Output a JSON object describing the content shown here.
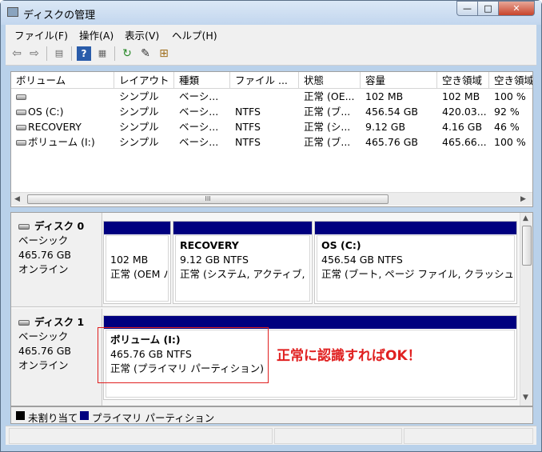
{
  "window": {
    "title": "ディスクの管理",
    "controls": [
      "—",
      "□",
      "✕"
    ]
  },
  "menu": [
    "ファイル(F)",
    "操作(A)",
    "表示(V)",
    "ヘルプ(H)"
  ],
  "toolbar": {
    "icons": [
      "back-arrow-icon",
      "forward-arrow-icon",
      "list-view-icon",
      "help-icon",
      "console-view-icon",
      "refresh-icon",
      "properties-icon",
      "rescan-icon"
    ]
  },
  "volume_list": {
    "columns": [
      "ボリューム",
      "レイアウト",
      "種類",
      "ファイル ...",
      "状態",
      "容量",
      "空き領域",
      "空き領域"
    ],
    "rows": [
      [
        "",
        "シンプル",
        "ベーシ...",
        "",
        "正常 (OE...",
        "102 MB",
        "102 MB",
        "100 %"
      ],
      [
        "OS (C:)",
        "シンプル",
        "ベーシ...",
        "NTFS",
        "正常 (ブ...",
        "456.54 GB",
        "420.03...",
        "92 %"
      ],
      [
        "RECOVERY",
        "シンプル",
        "ベーシ...",
        "NTFS",
        "正常 (シ...",
        "9.12 GB",
        "4.16 GB",
        "46 %"
      ],
      [
        "ボリューム (I:)",
        "シンプル",
        "ベーシ...",
        "NTFS",
        "正常 (ブ...",
        "465.76 GB",
        "465.66...",
        "100 %"
      ]
    ],
    "scroll_grip": "III"
  },
  "disks": [
    {
      "name": "ディスク 0",
      "type": "ベーシック",
      "size": "465.76 GB",
      "status": "オンライン",
      "partitions": [
        {
          "name": "",
          "size": "102 MB",
          "status": "正常 (OEM パ"
        },
        {
          "name": "RECOVERY",
          "size": "9.12 GB NTFS",
          "status": "正常 (システム, アクティブ, プ"
        },
        {
          "name": "OS  (C:)",
          "size": "456.54 GB NTFS",
          "status": "正常 (ブート, ページ ファイル, クラッシュ ダ"
        }
      ]
    },
    {
      "name": "ディスク 1",
      "type": "ベーシック",
      "size": "465.76 GB",
      "status": "オンライン",
      "partitions": [
        {
          "name": "ボリューム  (I:)",
          "size": "465.76 GB NTFS",
          "status": "正常 (プライマリ パーティション)"
        }
      ]
    }
  ],
  "annotation": "正常に認識すればOK！",
  "legend": [
    {
      "label": "未割り当て",
      "color": "#000000"
    },
    {
      "label": "プライマリ パーティション",
      "color": "#00007f"
    }
  ]
}
